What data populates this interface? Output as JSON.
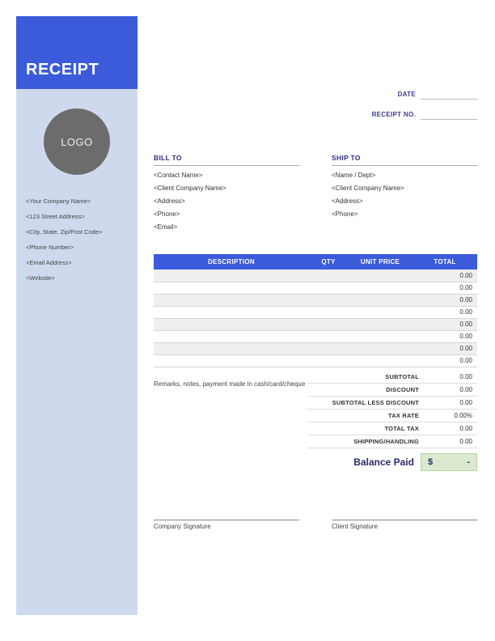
{
  "header": {
    "title": "RECEIPT",
    "logo_text": "LOGO"
  },
  "company": {
    "name": "<Your Company Name>",
    "street": "<123 Street Address>",
    "city": "<City, State, Zip/Post Code>",
    "phone": "<Phone Number>",
    "email": "<Email Address>",
    "website": "<Website>"
  },
  "meta": {
    "date_label": "DATE",
    "date_value": "",
    "receipt_no_label": "RECEIPT NO.",
    "receipt_no_value": ""
  },
  "bill_to": {
    "heading": "BILL TO",
    "contact": "<Contact Name>",
    "company": "<Client Company Name>",
    "address": "<Address>",
    "phone": "<Phone>",
    "email": "<Email>"
  },
  "ship_to": {
    "heading": "SHIP TO",
    "name_dept": "<Name / Dept>",
    "company": "<Client Company Name>",
    "address": "<Address>",
    "phone": "<Phone>"
  },
  "table": {
    "headers": {
      "description": "DESCRIPTION",
      "qty": "QTY",
      "unit_price": "UNIT PRICE",
      "total": "TOTAL"
    },
    "rows": [
      {
        "description": "",
        "qty": "",
        "unit_price": "",
        "total": "0.00"
      },
      {
        "description": "",
        "qty": "",
        "unit_price": "",
        "total": "0.00"
      },
      {
        "description": "",
        "qty": "",
        "unit_price": "",
        "total": "0.00"
      },
      {
        "description": "",
        "qty": "",
        "unit_price": "",
        "total": "0.00"
      },
      {
        "description": "",
        "qty": "",
        "unit_price": "",
        "total": "0.00"
      },
      {
        "description": "",
        "qty": "",
        "unit_price": "",
        "total": "0.00"
      },
      {
        "description": "",
        "qty": "",
        "unit_price": "",
        "total": "0.00"
      },
      {
        "description": "",
        "qty": "",
        "unit_price": "",
        "total": "0.00"
      }
    ]
  },
  "remarks": "Remarks, notes, payment made in cash/card/cheque",
  "totals": {
    "subtotal_label": "SUBTOTAL",
    "subtotal": "0.00",
    "discount_label": "DISCOUNT",
    "discount": "0.00",
    "subtotal_less_label": "SUBTOTAL LESS DISCOUNT",
    "subtotal_less": "0.00",
    "tax_rate_label": "TAX RATE",
    "tax_rate": "0.00%",
    "total_tax_label": "TOTAL TAX",
    "total_tax": "0.00",
    "shipping_label": "SHIPPING/HANDLING",
    "shipping": "0.00",
    "balance_label": "Balance Paid",
    "balance_currency": "$",
    "balance_value": "-"
  },
  "signatures": {
    "company": "Company Signature",
    "client": "Client Signature"
  }
}
